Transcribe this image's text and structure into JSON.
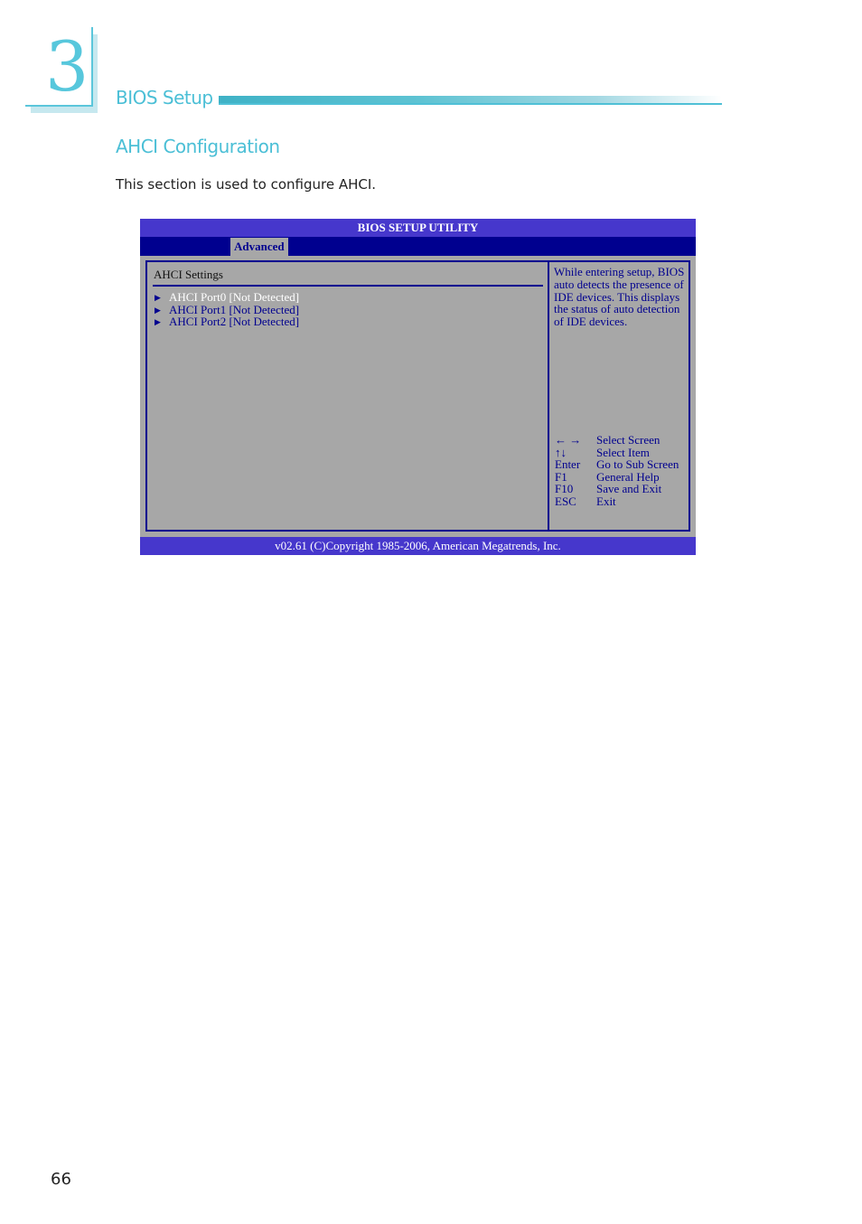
{
  "chapter": {
    "number": "3",
    "section_title": "BIOS Setup"
  },
  "heading": "AHCI Configuration",
  "intro": "This section is used to configure AHCI.",
  "bios": {
    "title": "BIOS SETUP UTILITY",
    "active_tab": "Advanced",
    "settings_label": "AHCI Settings",
    "menu_items": [
      {
        "label": "AHCI Port0 [Not Detected]",
        "selected": true
      },
      {
        "label": "AHCI Port1 [Not Detected]",
        "selected": false
      },
      {
        "label": "AHCI Port2 [Not Detected]",
        "selected": false
      }
    ],
    "help_text": "While entering setup, BIOS auto detects the presence of IDE devices. This displays the status of auto detection of IDE devices.",
    "keys": [
      {
        "key": "← →",
        "action": "Select Screen"
      },
      {
        "key": "↑↓",
        "action": "Select Item"
      },
      {
        "key": "Enter",
        "action": "Go to Sub Screen"
      },
      {
        "key": "F1",
        "action": "General Help"
      },
      {
        "key": "F10",
        "action": "Save and Exit"
      },
      {
        "key": "ESC",
        "action": "Exit"
      }
    ],
    "footer": "v02.61 (C)Copyright 1985-2006, American Megatrends, Inc."
  },
  "page_number": "66",
  "icons": {
    "submenu_arrow": "▶"
  }
}
